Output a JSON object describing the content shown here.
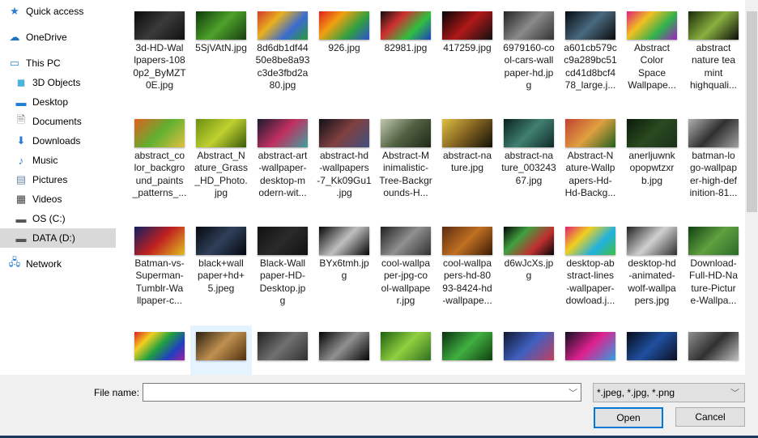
{
  "sidebar": {
    "items": [
      {
        "label": "Quick access",
        "icon": "star-icon",
        "glyph": "★",
        "color": "#2b7cd3",
        "indent": 0,
        "selected": false
      },
      {
        "label": "OneDrive",
        "icon": "cloud-icon",
        "glyph": "☁",
        "color": "#1e73c8",
        "indent": 0,
        "selected": false
      },
      {
        "label": "This PC",
        "icon": "computer-icon",
        "glyph": "▭",
        "color": "#2a8ad4",
        "indent": 0,
        "selected": false
      },
      {
        "label": "3D Objects",
        "icon": "cube-icon",
        "glyph": "◼",
        "color": "#4db3d9",
        "indent": 1,
        "selected": false
      },
      {
        "label": "Desktop",
        "icon": "desktop-icon",
        "glyph": "▬",
        "color": "#1e7fd6",
        "indent": 1,
        "selected": false
      },
      {
        "label": "Documents",
        "icon": "document-icon",
        "glyph": "🗎",
        "color": "#777777",
        "indent": 1,
        "selected": false
      },
      {
        "label": "Downloads",
        "icon": "download-arrow-icon",
        "glyph": "⬇",
        "color": "#2b7cd3",
        "indent": 1,
        "selected": false
      },
      {
        "label": "Music",
        "icon": "music-note-icon",
        "glyph": "♪",
        "color": "#2b7cd3",
        "indent": 1,
        "selected": false
      },
      {
        "label": "Pictures",
        "icon": "picture-icon",
        "glyph": "▤",
        "color": "#6a8aa8",
        "indent": 1,
        "selected": false
      },
      {
        "label": "Videos",
        "icon": "film-icon",
        "glyph": "▦",
        "color": "#444444",
        "indent": 1,
        "selected": false
      },
      {
        "label": "OS (C:)",
        "icon": "drive-os-icon",
        "glyph": "▬",
        "color": "#555555",
        "indent": 1,
        "selected": false
      },
      {
        "label": "DATA (D:)",
        "icon": "drive-icon",
        "glyph": "▬",
        "color": "#555555",
        "indent": 1,
        "selected": true
      },
      {
        "label": "Network",
        "icon": "network-icon",
        "glyph": "🖧",
        "color": "#2b7cd3",
        "indent": 0,
        "selected": false
      }
    ]
  },
  "files": [
    {
      "label": "3d-HD-Wal\nlpapers-108\n0p2_ByMZT\n0E.jpg",
      "colors": [
        "#0a0a0a",
        "#3a3a3a",
        "#111"
      ]
    },
    {
      "label": "5SjVAtN.jpg",
      "colors": [
        "#0f3a0a",
        "#4ea12a",
        "#173d10"
      ]
    },
    {
      "label": "8d6db1df44\n50e8be8a93\nc3de3fbd2a\n80.jpg",
      "colors": [
        "#d23a2a",
        "#e8b020",
        "#3a6ad0",
        "#2a9a3a"
      ]
    },
    {
      "label": "926.jpg",
      "colors": [
        "#e02020",
        "#f0a010",
        "#30a040",
        "#3050d0"
      ]
    },
    {
      "label": "82981.jpg",
      "colors": [
        "#101010",
        "#d03030",
        "#30c040",
        "#2040c0"
      ]
    },
    {
      "label": "417259.jpg",
      "colors": [
        "#050505",
        "#b01818",
        "#101010"
      ]
    },
    {
      "label": "6979160-co\nol-cars-wall\npaper-hd.jp\ng",
      "colors": [
        "#222",
        "#8a8a8a",
        "#333"
      ]
    },
    {
      "label": "a601cb579c\nc9a289bc51\ncd41d8bcf4\n78_large.j...",
      "colors": [
        "#050a10",
        "#4a6a80",
        "#0a0a0a"
      ]
    },
    {
      "label": "Abstract\nColor\nSpace\nWallpape...",
      "colors": [
        "#e0207a",
        "#f0c020",
        "#30b050",
        "#a020c0"
      ]
    },
    {
      "label": "abstract\nnature tea\nmint\nhighquali...",
      "colors": [
        "#1a2a08",
        "#8ab040",
        "#0a0a0a"
      ]
    },
    {
      "label": "abstract_co\nlor_backgro\nund_paints\n_patterns_...",
      "colors": [
        "#e06020",
        "#60b030",
        "#e0c040"
      ]
    },
    {
      "label": "Abstract_N\nature_Grass\n_HD_Photo.\njpg",
      "colors": [
        "#6a9010",
        "#c0d030",
        "#3a5a08"
      ]
    },
    {
      "label": "abstract-art\n-wallpaper-\ndesktop-m\nodern-wit...",
      "colors": [
        "#1a1a30",
        "#c03060",
        "#40a0a0"
      ]
    },
    {
      "label": "abstract-hd\n-wallpapers\n-7_Kk09Gu1\n.jpg",
      "colors": [
        "#101018",
        "#804040",
        "#405080"
      ]
    },
    {
      "label": "Abstract-M\ninimalistic-\nTree-Backgr\nounds-H...",
      "colors": [
        "#c0c8b0",
        "#506040",
        "#202818"
      ]
    },
    {
      "label": "abstract-na\nture.jpg",
      "colors": [
        "#e0c040",
        "#806020",
        "#101008"
      ]
    },
    {
      "label": "abstract-na\nture_003243\n67.jpg",
      "colors": [
        "#0a2020",
        "#408070",
        "#102a28"
      ]
    },
    {
      "label": "Abstract-N\nature-Wallp\napers-Hd-\nHd-Backg...",
      "colors": [
        "#c04030",
        "#e0a040",
        "#206020"
      ]
    },
    {
      "label": "anerljuwnk\nopopwtzxr\nb.jpg",
      "colors": [
        "#0a1a0a",
        "#2a4a20",
        "#1a301a"
      ]
    },
    {
      "label": "batman-lo\ngo-wallpap\ner-high-def\ninition-81...",
      "colors": [
        "#b0b0b0",
        "#303030",
        "#a0a0a0"
      ]
    },
    {
      "label": "Batman-vs-\nSuperman-\nTumblr-Wa\nllpaper-c...",
      "colors": [
        "#102060",
        "#c02020",
        "#e0c020"
      ]
    },
    {
      "label": "black+wall\npaper+hd+\n5.jpeg",
      "colors": [
        "#05080f",
        "#30405a",
        "#05080f"
      ]
    },
    {
      "label": "Black-Wall\npaper-HD-\nDesktop.jp\ng",
      "colors": [
        "#101010",
        "#2a2a2a",
        "#101010"
      ]
    },
    {
      "label": "BYx6tmh.jp\ng",
      "colors": [
        "#050505",
        "#c0c0c0",
        "#050505"
      ]
    },
    {
      "label": "cool-wallpa\nper-jpg-co\nol-wallpape\nr.jpg",
      "colors": [
        "#202020",
        "#909090",
        "#303030"
      ]
    },
    {
      "label": "cool-wallpa\npers-hd-80\n93-8424-hd\n-wallpape...",
      "colors": [
        "#5a2a10",
        "#c07020",
        "#3a1a08"
      ]
    },
    {
      "label": "d6wJcXs.jp\ng",
      "colors": [
        "#050505",
        "#40a040",
        "#c03030",
        "#050505"
      ]
    },
    {
      "label": "desktop-ab\nstract-lines\n-wallpaper-\ndowload.j...",
      "colors": [
        "#e02070",
        "#f0d020",
        "#20b0e0",
        "#40c040"
      ]
    },
    {
      "label": "desktop-hd\n-animated-\nwolf-wallpa\npers.jpg",
      "colors": [
        "#202020",
        "#d0d0d0",
        "#303030"
      ]
    },
    {
      "label": "Download-\nFull-HD-Na\nture-Pictur\ne-Wallpa...",
      "colors": [
        "#104010",
        "#60a040",
        "#2a6a2a"
      ]
    },
    {
      "label": "",
      "colors": [
        "#e02020",
        "#f0d020",
        "#20a040",
        "#2040c0",
        "#a020a0"
      ]
    },
    {
      "label": "",
      "colors": [
        "#2a2010",
        "#c09050",
        "#503010"
      ]
    },
    {
      "label": "",
      "colors": [
        "#202020",
        "#707070",
        "#303030"
      ]
    },
    {
      "label": "",
      "colors": [
        "#050505",
        "#909090",
        "#050505"
      ]
    },
    {
      "label": "",
      "colors": [
        "#206010",
        "#90d040",
        "#307020"
      ]
    },
    {
      "label": "",
      "colors": [
        "#0a3010",
        "#40b040",
        "#104010"
      ]
    },
    {
      "label": "",
      "colors": [
        "#101830",
        "#4060c0",
        "#c04060"
      ]
    },
    {
      "label": "",
      "colors": [
        "#101020",
        "#e02090",
        "#30a0e0"
      ]
    },
    {
      "label": "",
      "colors": [
        "#050a18",
        "#2050a0",
        "#0a1020"
      ]
    },
    {
      "label": "",
      "colors": [
        "#909090",
        "#303030",
        "#c0c0c0"
      ]
    }
  ],
  "selected_file_index": 31,
  "footer": {
    "file_name_label": "File name:",
    "file_name_value": "",
    "file_type_filter": "*.jpeg, *.jpg, *.png",
    "open_label": "Open",
    "cancel_label": "Cancel"
  }
}
